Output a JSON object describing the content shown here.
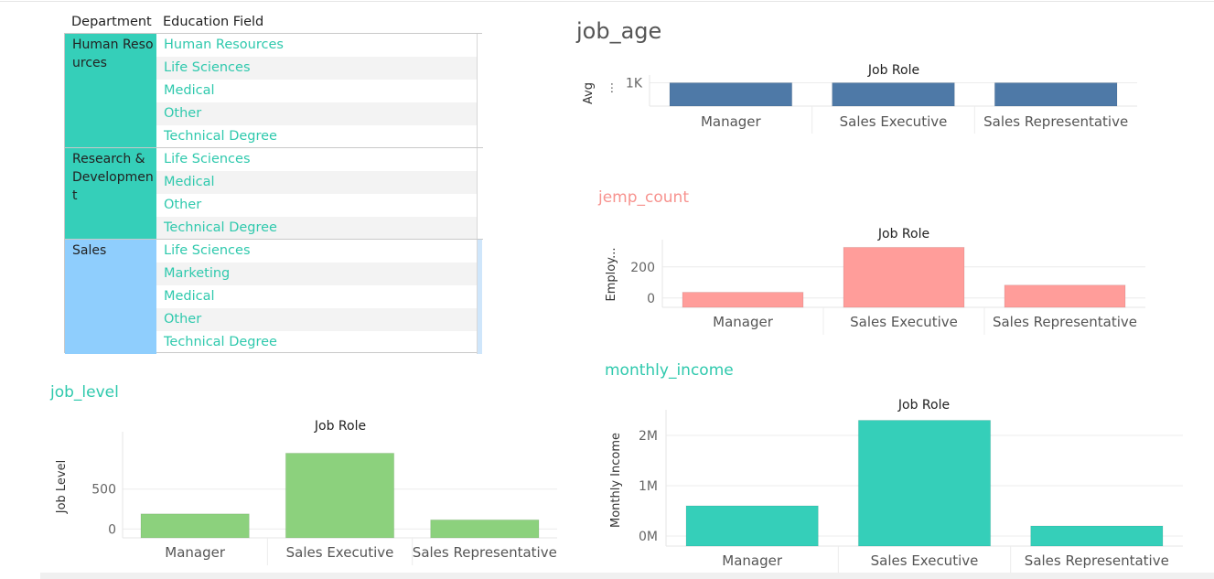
{
  "table": {
    "headers": {
      "department": "Department",
      "education": "Education Field"
    },
    "groups": [
      {
        "department": "Human Resources",
        "color": "#35cfb9",
        "fields": [
          "Human Resources",
          "Life Sciences",
          "Medical",
          "Other",
          "Technical Degree"
        ]
      },
      {
        "department": "Research & Development",
        "color": "#35cfb9",
        "fields": [
          "Life Sciences",
          "Medical",
          "Other",
          "Technical Degree"
        ]
      },
      {
        "department": "Sales",
        "color": "#8fcefd",
        "fields": [
          "Life Sciences",
          "Marketing",
          "Medical",
          "Other",
          "Technical Degree"
        ]
      }
    ]
  },
  "charts": {
    "job_age": {
      "title": "job_age",
      "title_color": "#555555"
    },
    "jemp_count": {
      "title": "jemp_count",
      "title_color": "#f7938f"
    },
    "monthly_income": {
      "title": "monthly_income",
      "title_color": "#2fc9ad"
    },
    "job_level": {
      "title": "job_level",
      "title_color": "#2fc9ad"
    }
  },
  "chart_data": [
    {
      "id": "job_age",
      "type": "bar",
      "header": "Job Role",
      "ylabel": "Avg",
      "categories": [
        "Manager",
        "Sales Executive",
        "Sales Representative"
      ],
      "values": [
        1000,
        1000,
        1000
      ],
      "ylim": [
        0,
        1100
      ],
      "ticks": [
        {
          "v": 1000,
          "label": "1K"
        }
      ],
      "color": "#4e79a7"
    },
    {
      "id": "jemp_count",
      "type": "bar",
      "header": "Job Role",
      "ylabel": "Employ...",
      "categories": [
        "Manager",
        "Sales Executive",
        "Sales Representative"
      ],
      "values": [
        37,
        326,
        83
      ],
      "ylim": [
        -60,
        340
      ],
      "ticks": [
        {
          "v": 0,
          "label": "0"
        },
        {
          "v": 200,
          "label": "200"
        }
      ],
      "color": "#ff9d9a"
    },
    {
      "id": "monthly_income",
      "type": "bar",
      "header": "Job Role",
      "ylabel": "Monthly Income",
      "categories": [
        "Manager",
        "Sales Executive",
        "Sales Representative"
      ],
      "values": [
        600000,
        2300000,
        200000
      ],
      "ylim": [
        -200000,
        2400000
      ],
      "ticks": [
        {
          "v": 0,
          "label": "0M"
        },
        {
          "v": 1000000,
          "label": "1M"
        },
        {
          "v": 2000000,
          "label": "2M"
        }
      ],
      "color": "#35cfb9"
    },
    {
      "id": "job_level",
      "type": "bar",
      "header": "Job Role",
      "ylabel": "Job Level",
      "categories": [
        "Manager",
        "Sales Executive",
        "Sales Representative"
      ],
      "values": [
        190,
        950,
        115
      ],
      "ylim": [
        -110,
        1150
      ],
      "ticks": [
        {
          "v": 0,
          "label": "0"
        },
        {
          "v": 500,
          "label": "500"
        }
      ],
      "color": "#8cd17d"
    }
  ]
}
